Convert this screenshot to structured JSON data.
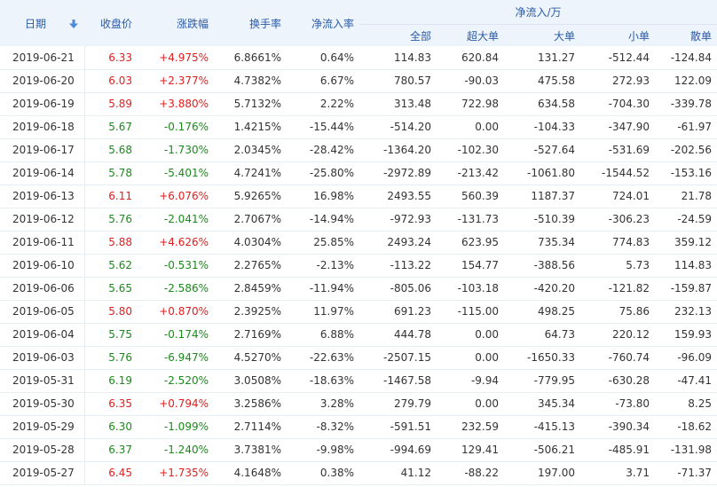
{
  "header": {
    "date": "日期",
    "close": "收盘价",
    "change": "涨跌幅",
    "turnover": "换手率",
    "net_ratio": "净流入率",
    "net_group": "净流入/万",
    "all": "全部",
    "super_large": "超大单",
    "large": "大单",
    "small": "小单",
    "retail": "散单"
  },
  "rows": [
    {
      "date": "2019-06-21",
      "close": "6.33",
      "change": "+4.975%",
      "turnover": "6.8661%",
      "net_ratio": "0.64%",
      "all": "114.83",
      "super_large": "620.84",
      "large": "131.27",
      "small": "-512.44",
      "retail": "-124.84",
      "trend": "up"
    },
    {
      "date": "2019-06-20",
      "close": "6.03",
      "change": "+2.377%",
      "turnover": "4.7382%",
      "net_ratio": "6.67%",
      "all": "780.57",
      "super_large": "-90.03",
      "large": "475.58",
      "small": "272.93",
      "retail": "122.09",
      "trend": "up"
    },
    {
      "date": "2019-06-19",
      "close": "5.89",
      "change": "+3.880%",
      "turnover": "5.7132%",
      "net_ratio": "2.22%",
      "all": "313.48",
      "super_large": "722.98",
      "large": "634.58",
      "small": "-704.30",
      "retail": "-339.78",
      "trend": "up"
    },
    {
      "date": "2019-06-18",
      "close": "5.67",
      "change": "-0.176%",
      "turnover": "1.4215%",
      "net_ratio": "-15.44%",
      "all": "-514.20",
      "super_large": "0.00",
      "large": "-104.33",
      "small": "-347.90",
      "retail": "-61.97",
      "trend": "down"
    },
    {
      "date": "2019-06-17",
      "close": "5.68",
      "change": "-1.730%",
      "turnover": "2.0345%",
      "net_ratio": "-28.42%",
      "all": "-1364.20",
      "super_large": "-102.30",
      "large": "-527.64",
      "small": "-531.69",
      "retail": "-202.56",
      "trend": "down"
    },
    {
      "date": "2019-06-14",
      "close": "5.78",
      "change": "-5.401%",
      "turnover": "4.7241%",
      "net_ratio": "-25.80%",
      "all": "-2972.89",
      "super_large": "-213.42",
      "large": "-1061.80",
      "small": "-1544.52",
      "retail": "-153.16",
      "trend": "down"
    },
    {
      "date": "2019-06-13",
      "close": "6.11",
      "change": "+6.076%",
      "turnover": "5.9265%",
      "net_ratio": "16.98%",
      "all": "2493.55",
      "super_large": "560.39",
      "large": "1187.37",
      "small": "724.01",
      "retail": "21.78",
      "trend": "up"
    },
    {
      "date": "2019-06-12",
      "close": "5.76",
      "change": "-2.041%",
      "turnover": "2.7067%",
      "net_ratio": "-14.94%",
      "all": "-972.93",
      "super_large": "-131.73",
      "large": "-510.39",
      "small": "-306.23",
      "retail": "-24.59",
      "trend": "down"
    },
    {
      "date": "2019-06-11",
      "close": "5.88",
      "change": "+4.626%",
      "turnover": "4.0304%",
      "net_ratio": "25.85%",
      "all": "2493.24",
      "super_large": "623.95",
      "large": "735.34",
      "small": "774.83",
      "retail": "359.12",
      "trend": "up"
    },
    {
      "date": "2019-06-10",
      "close": "5.62",
      "change": "-0.531%",
      "turnover": "2.2765%",
      "net_ratio": "-2.13%",
      "all": "-113.22",
      "super_large": "154.77",
      "large": "-388.56",
      "small": "5.73",
      "retail": "114.83",
      "trend": "down"
    },
    {
      "date": "2019-06-06",
      "close": "5.65",
      "change": "-2.586%",
      "turnover": "2.8459%",
      "net_ratio": "-11.94%",
      "all": "-805.06",
      "super_large": "-103.18",
      "large": "-420.20",
      "small": "-121.82",
      "retail": "-159.87",
      "trend": "down"
    },
    {
      "date": "2019-06-05",
      "close": "5.80",
      "change": "+0.870%",
      "turnover": "2.3925%",
      "net_ratio": "11.97%",
      "all": "691.23",
      "super_large": "-115.00",
      "large": "498.25",
      "small": "75.86",
      "retail": "232.13",
      "trend": "up"
    },
    {
      "date": "2019-06-04",
      "close": "5.75",
      "change": "-0.174%",
      "turnover": "2.7169%",
      "net_ratio": "6.88%",
      "all": "444.78",
      "super_large": "0.00",
      "large": "64.73",
      "small": "220.12",
      "retail": "159.93",
      "trend": "down"
    },
    {
      "date": "2019-06-03",
      "close": "5.76",
      "change": "-6.947%",
      "turnover": "4.5270%",
      "net_ratio": "-22.63%",
      "all": "-2507.15",
      "super_large": "0.00",
      "large": "-1650.33",
      "small": "-760.74",
      "retail": "-96.09",
      "trend": "down"
    },
    {
      "date": "2019-05-31",
      "close": "6.19",
      "change": "-2.520%",
      "turnover": "3.0508%",
      "net_ratio": "-18.63%",
      "all": "-1467.58",
      "super_large": "-9.94",
      "large": "-779.95",
      "small": "-630.28",
      "retail": "-47.41",
      "trend": "down"
    },
    {
      "date": "2019-05-30",
      "close": "6.35",
      "change": "+0.794%",
      "turnover": "3.2586%",
      "net_ratio": "3.28%",
      "all": "279.79",
      "super_large": "0.00",
      "large": "345.34",
      "small": "-73.80",
      "retail": "8.25",
      "trend": "up"
    },
    {
      "date": "2019-05-29",
      "close": "6.30",
      "change": "-1.099%",
      "turnover": "2.7114%",
      "net_ratio": "-8.32%",
      "all": "-591.51",
      "super_large": "232.59",
      "large": "-415.13",
      "small": "-390.34",
      "retail": "-18.62",
      "trend": "down"
    },
    {
      "date": "2019-05-28",
      "close": "6.37",
      "change": "-1.240%",
      "turnover": "3.7381%",
      "net_ratio": "-9.98%",
      "all": "-994.69",
      "super_large": "129.41",
      "large": "-506.21",
      "small": "-485.91",
      "retail": "-131.98",
      "trend": "down"
    },
    {
      "date": "2019-05-27",
      "close": "6.45",
      "change": "+1.735%",
      "turnover": "4.1648%",
      "net_ratio": "0.38%",
      "all": "41.12",
      "super_large": "-88.22",
      "large": "197.00",
      "small": "3.71",
      "retail": "-71.37",
      "trend": "up"
    }
  ],
  "colors": {
    "up": "#e01e1e",
    "down": "#1b8a1b",
    "header_bg": "#eef4fc",
    "header_text": "#2a5aa6"
  },
  "icons": {
    "sort": "sort-down-arrow-icon"
  }
}
